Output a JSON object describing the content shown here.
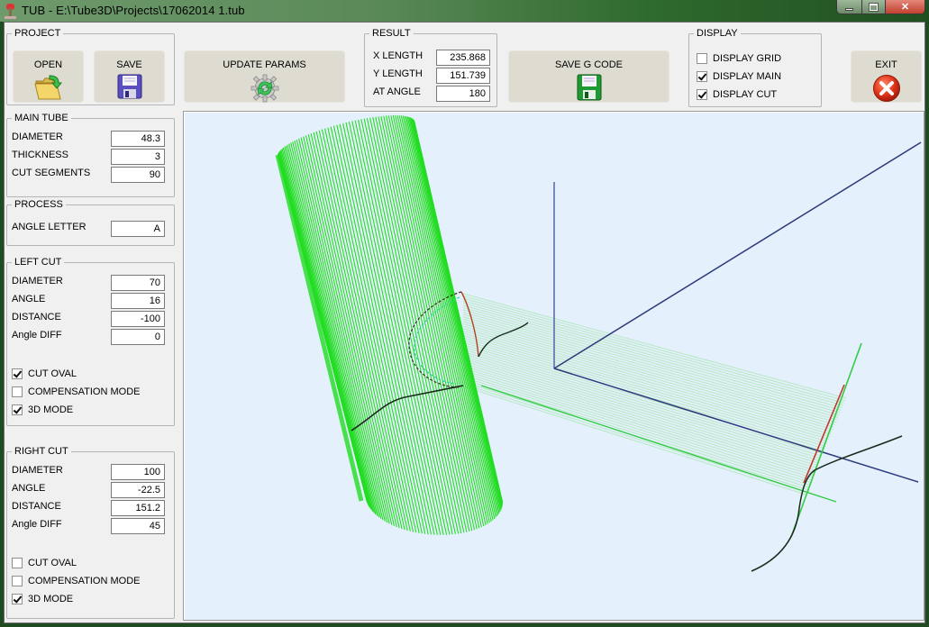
{
  "window": {
    "title": "TUB - E:\\Tube3D\\Projects\\17062014 1.tub",
    "controls": {
      "minimize": "minimize",
      "maximize": "maximize",
      "close": "close"
    }
  },
  "project": {
    "legend": "PROJECT",
    "open_label": "OPEN",
    "save_label": "SAVE"
  },
  "update_params": {
    "label": "UPDATE PARAMS"
  },
  "result": {
    "legend": "RESULT",
    "rows": [
      {
        "label": "X LENGTH",
        "value": "235.868"
      },
      {
        "label": "Y LENGTH",
        "value": "151.739"
      },
      {
        "label": "AT ANGLE",
        "value": "180"
      }
    ]
  },
  "save_gcode": {
    "label": "SAVE G CODE"
  },
  "display": {
    "legend": "DISPLAY",
    "options": [
      {
        "label": "DISPLAY GRID",
        "checked": false
      },
      {
        "label": "DISPLAY MAIN",
        "checked": true
      },
      {
        "label": "DISPLAY CUT",
        "checked": true
      }
    ]
  },
  "exit": {
    "label": "EXIT"
  },
  "main_tube": {
    "legend": "MAIN TUBE",
    "fields": [
      {
        "label": "DIAMETER",
        "value": "48.3"
      },
      {
        "label": "THICKNESS",
        "value": "3"
      },
      {
        "label": "CUT SEGMENTS",
        "value": "90"
      }
    ]
  },
  "process": {
    "legend": "PROCESS",
    "fields": [
      {
        "label": "ANGLE LETTER",
        "value": "A"
      }
    ]
  },
  "left_cut": {
    "legend": "LEFT CUT",
    "fields": [
      {
        "label": "DIAMETER",
        "value": "70"
      },
      {
        "label": "ANGLE",
        "value": "16"
      },
      {
        "label": "DISTANCE",
        "value": "-100"
      },
      {
        "label": "Angle DIFF",
        "value": "0"
      }
    ],
    "options": [
      {
        "label": "CUT OVAL",
        "checked": true
      },
      {
        "label": "COMPENSATION MODE",
        "checked": false
      },
      {
        "label": "3D MODE",
        "checked": true
      }
    ]
  },
  "right_cut": {
    "legend": "RIGHT CUT",
    "fields": [
      {
        "label": "DIAMETER",
        "value": "100"
      },
      {
        "label": "ANGLE",
        "value": "-22.5"
      },
      {
        "label": "DISTANCE",
        "value": "151.2"
      },
      {
        "label": "Angle DIFF",
        "value": "45"
      }
    ],
    "options": [
      {
        "label": "CUT OVAL",
        "checked": false
      },
      {
        "label": "COMPENSATION MODE",
        "checked": false
      },
      {
        "label": "3D MODE",
        "checked": true
      }
    ]
  },
  "colors": {
    "viewport_bg": "#e4f0fc",
    "tube_green": "#22dd22",
    "tube_light": "#a8e6b0",
    "axis_blue": "#2a3a7a",
    "cut_red": "#c0392b",
    "cut_black": "#1a2a1a"
  }
}
